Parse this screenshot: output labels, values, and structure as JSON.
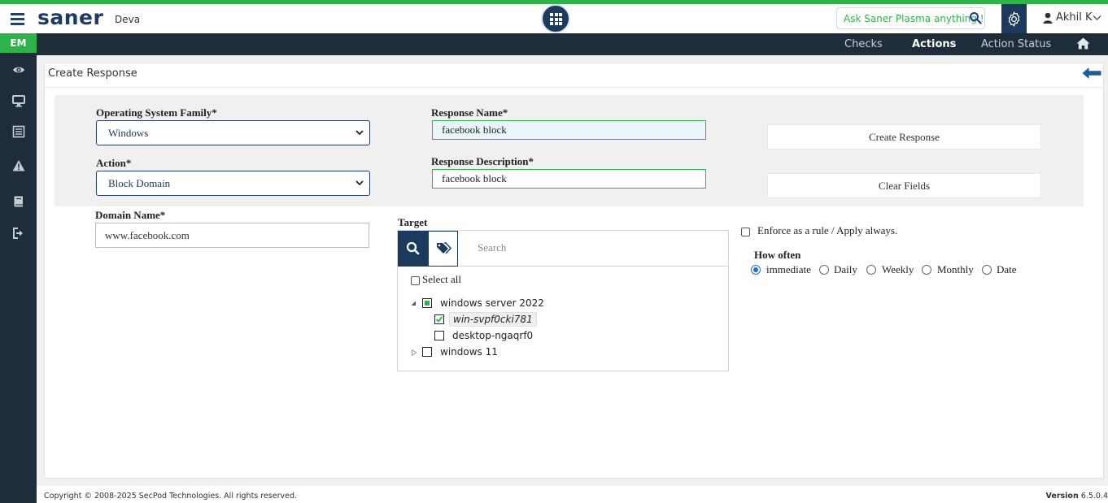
{
  "header": {
    "logo": "saner",
    "org": "Deva",
    "ask_placeholder": "Ask Saner Plasma anything !",
    "user_name": "Akhil K"
  },
  "nav": {
    "items": [
      {
        "label": "Checks"
      },
      {
        "label": "Actions"
      },
      {
        "label": "Action Status"
      }
    ],
    "active": "Actions"
  },
  "sidebar": {
    "module_tab": "EM",
    "icons": [
      "eye-icon",
      "monitor-icon",
      "list-icon",
      "alert-icon",
      "book-icon",
      "logout-icon"
    ]
  },
  "page": {
    "title": "Create Response"
  },
  "form": {
    "os_family_label": "Operating System Family*",
    "os_family_value": "Windows",
    "action_label": "Action*",
    "action_value": "Block Domain",
    "response_name_label": "Response Name*",
    "response_name_value": "facebook block",
    "response_desc_label": "Response Description*",
    "response_desc_value": "facebook block",
    "create_button": "Create Response",
    "clear_button": "Clear Fields",
    "domain_label": "Domain Name*",
    "domain_value": "www.facebook.com"
  },
  "target": {
    "label": "Target",
    "search_placeholder": "Search",
    "select_all": "Select all",
    "tree": [
      {
        "label": "windows server 2022",
        "state": "partial",
        "expanded": true,
        "children": [
          {
            "label": "win-svpf0cki781",
            "checked": true
          },
          {
            "label": "desktop-ngaqrf0",
            "checked": false
          }
        ]
      },
      {
        "label": "windows 11",
        "state": "unchecked",
        "expanded": false
      }
    ]
  },
  "schedule": {
    "enforce_label": "Enforce as a rule / Apply always.",
    "how_often_label": "How often",
    "options": [
      "immediate",
      "Daily",
      "Weekly",
      "Monthly",
      "Date"
    ],
    "selected": "immediate"
  },
  "footer": {
    "copyright": "Copyright © 2008-2025 SecPod Technologies. All rights reserved.",
    "version_label": "Version",
    "version_value": "6.5.0.4"
  },
  "colors": {
    "brand_green": "#2db34a",
    "navy": "#1c3a5e",
    "nav_bg": "#1f2d3a"
  }
}
